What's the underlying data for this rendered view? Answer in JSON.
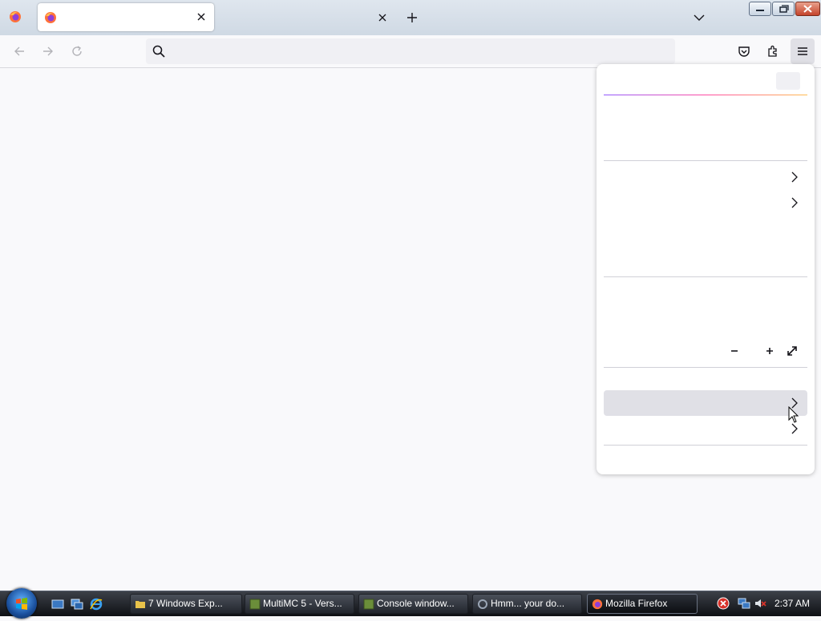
{
  "browser": {
    "active_tab_title": "",
    "url_value": "",
    "url_placeholder": ""
  },
  "taskbar": {
    "buttons": [
      {
        "label": "7 Windows Exp..."
      },
      {
        "label": "MultiMC 5 - Vers..."
      },
      {
        "label": "Console window..."
      },
      {
        "label": "Hmm... your do..."
      },
      {
        "label": "Mozilla Firefox"
      }
    ],
    "clock": "2:37 AM"
  },
  "colors": {
    "firefox_orange": "#ff7139",
    "menu_accent": "#9059ff"
  }
}
